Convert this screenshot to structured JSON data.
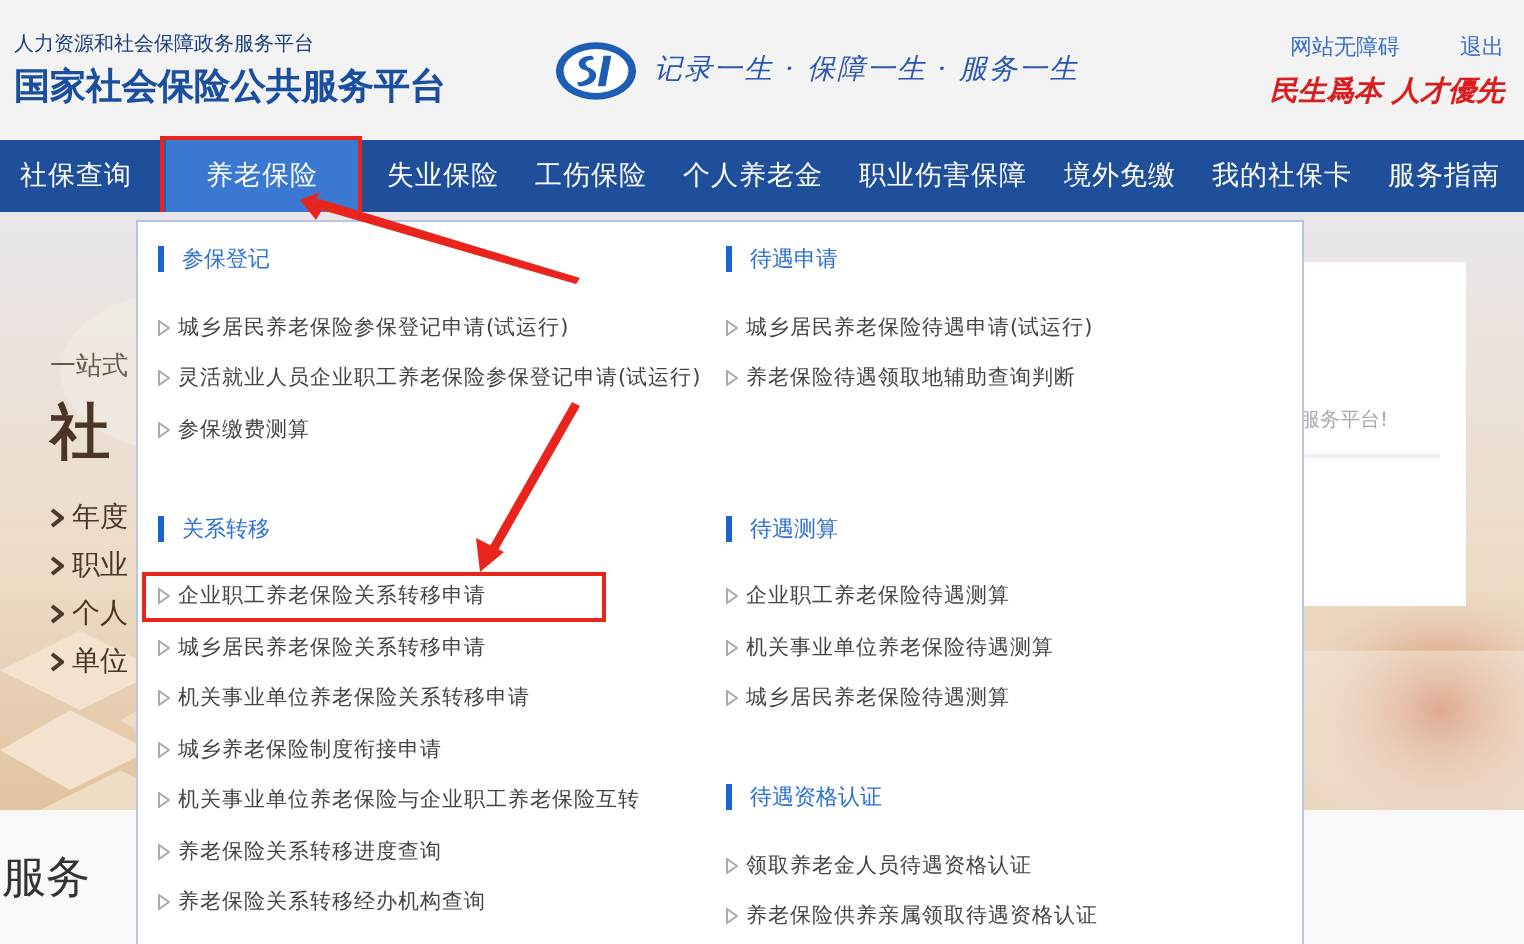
{
  "header": {
    "subtitle": "人力资源和社会保障政务服务平台",
    "title": "国家社会保险公共服务平台",
    "slogan": "记录一生 · 保障一生 · 服务一生",
    "motto": "民生爲本 人才優先",
    "links": [
      "网站无障碍",
      "退出"
    ]
  },
  "nav": [
    {
      "label": "社保查询",
      "selected": false,
      "highlighted": false
    },
    {
      "label": "养老保险",
      "selected": true,
      "highlighted": true
    },
    {
      "label": "失业保险",
      "selected": false,
      "highlighted": false
    },
    {
      "label": "工伤保险",
      "selected": false,
      "highlighted": false
    },
    {
      "label": "个人养老金",
      "selected": false,
      "highlighted": false
    },
    {
      "label": "职业伤害保障",
      "selected": false,
      "highlighted": false
    },
    {
      "label": "境外免缴",
      "selected": false,
      "highlighted": false
    },
    {
      "label": "我的社保卡",
      "selected": false,
      "highlighted": false
    },
    {
      "label": "服务指南",
      "selected": false,
      "highlighted": false
    }
  ],
  "hero": {
    "tagline": "一站式",
    "heading": "社",
    "bullets": [
      "年度",
      "职业",
      "个人",
      "单位"
    ],
    "card_text": "服务平台!"
  },
  "dropdown": {
    "rows": [
      [
        [
          {
            "title": "参保登记",
            "items": [
              {
                "label": "城乡居民养老保险参保登记申请(试运行)",
                "highlighted": false
              },
              {
                "label": "灵活就业人员企业职工养老保险参保登记申请(试运行)",
                "highlighted": false
              },
              {
                "label": "参保缴费测算",
                "highlighted": false
              }
            ]
          }
        ],
        [
          {
            "title": "待遇申请",
            "items": [
              {
                "label": "城乡居民养老保险待遇申请(试运行)",
                "highlighted": false
              },
              {
                "label": "养老保险待遇领取地辅助查询判断",
                "highlighted": false
              }
            ]
          }
        ]
      ],
      [
        [
          {
            "title": "关系转移",
            "items": [
              {
                "label": "企业职工养老保险关系转移申请",
                "highlighted": true
              },
              {
                "label": "城乡居民养老保险关系转移申请",
                "highlighted": false
              },
              {
                "label": "机关事业单位养老保险关系转移申请",
                "highlighted": false
              },
              {
                "label": "城乡养老保险制度衔接申请",
                "highlighted": false
              },
              {
                "label": "机关事业单位养老保险与企业职工养老保险互转",
                "highlighted": false
              },
              {
                "label": "养老保险关系转移进度查询",
                "highlighted": false
              },
              {
                "label": "养老保险关系转移经办机构查询",
                "highlighted": false
              }
            ]
          }
        ],
        [
          {
            "title": "待遇测算",
            "items": [
              {
                "label": "企业职工养老保险待遇测算",
                "highlighted": false
              },
              {
                "label": "机关事业单位养老保险待遇测算",
                "highlighted": false
              },
              {
                "label": "城乡居民养老保险待遇测算",
                "highlighted": false
              }
            ]
          },
          {
            "title": "待遇资格认证",
            "items": [
              {
                "label": "领取养老金人员待遇资格认证",
                "highlighted": false
              },
              {
                "label": "养老保险供养亲属领取待遇资格认证",
                "highlighted": false
              }
            ]
          }
        ]
      ]
    ]
  },
  "section_title": "服务"
}
